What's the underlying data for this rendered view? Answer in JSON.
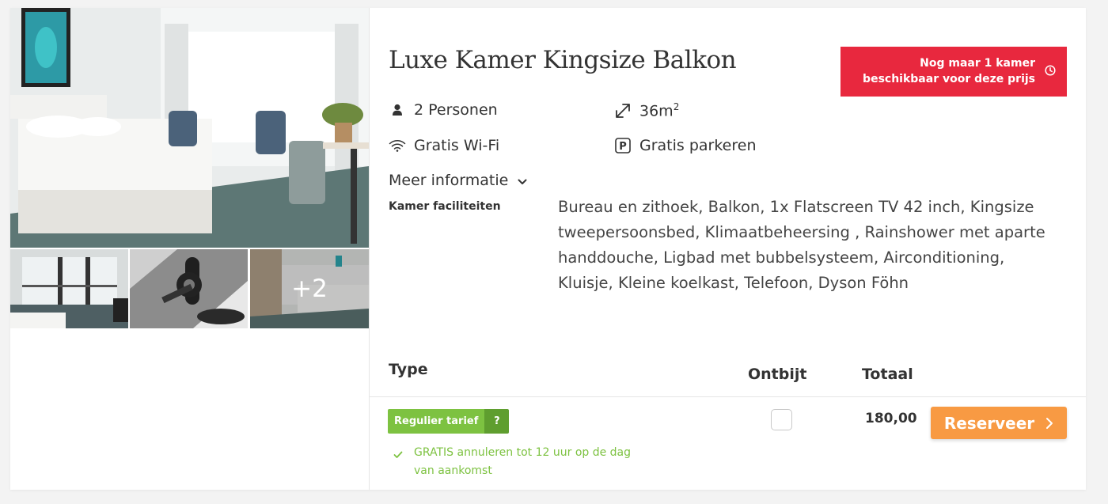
{
  "room": {
    "title": "Luxe Kamer Kingsize Balkon",
    "availability_badge": "Nog maar 1 kamer beschikbaar voor deze prijs",
    "features": {
      "persons": "2 Personen",
      "size": "36m",
      "size_unit_sup": "2",
      "wifi": "Gratis Wi-Fi",
      "parking": "Gratis parkeren"
    },
    "more_info_label": "Meer informatie",
    "facilities_label": "Kamer faciliteiten",
    "facilities_text": "Bureau en zithoek, Balkon, 1x Flatscreen TV 42 inch, Kingsize tweepersoonsbed, Klimaatbeheersing , Rainshower met aparte handdouche, Ligbad met bubbelsysteem, Airconditioning, Kluisje, Kleine koelkast, Telefoon, Dyson Föhn"
  },
  "gallery": {
    "more_photos_label": "+2"
  },
  "rates_table": {
    "headers": {
      "type": "Type",
      "breakfast": "Ontbijt",
      "total": "Totaal"
    },
    "rows": [
      {
        "rate_name": "Regulier tarief",
        "info_label": "?",
        "cancellation": "GRATIS annuleren tot 12 uur op de dag van aankomst",
        "breakfast_checked": false,
        "price": "180,00",
        "reserve_label": "Reserveer"
      }
    ]
  },
  "colors": {
    "badge": "#e8283e",
    "rate_green": "#7dc241",
    "rate_green_dark": "#5f9e2f",
    "reserve_orange": "#f89a43"
  },
  "icons": {
    "persons": "person-icon",
    "size": "expand-arrows-icon",
    "wifi": "wifi-icon",
    "parking": "parking-icon",
    "badge": "clock-icon",
    "more_info": "chevron-down-icon",
    "cancellation": "check-icon",
    "reserve": "chevron-right-icon"
  }
}
